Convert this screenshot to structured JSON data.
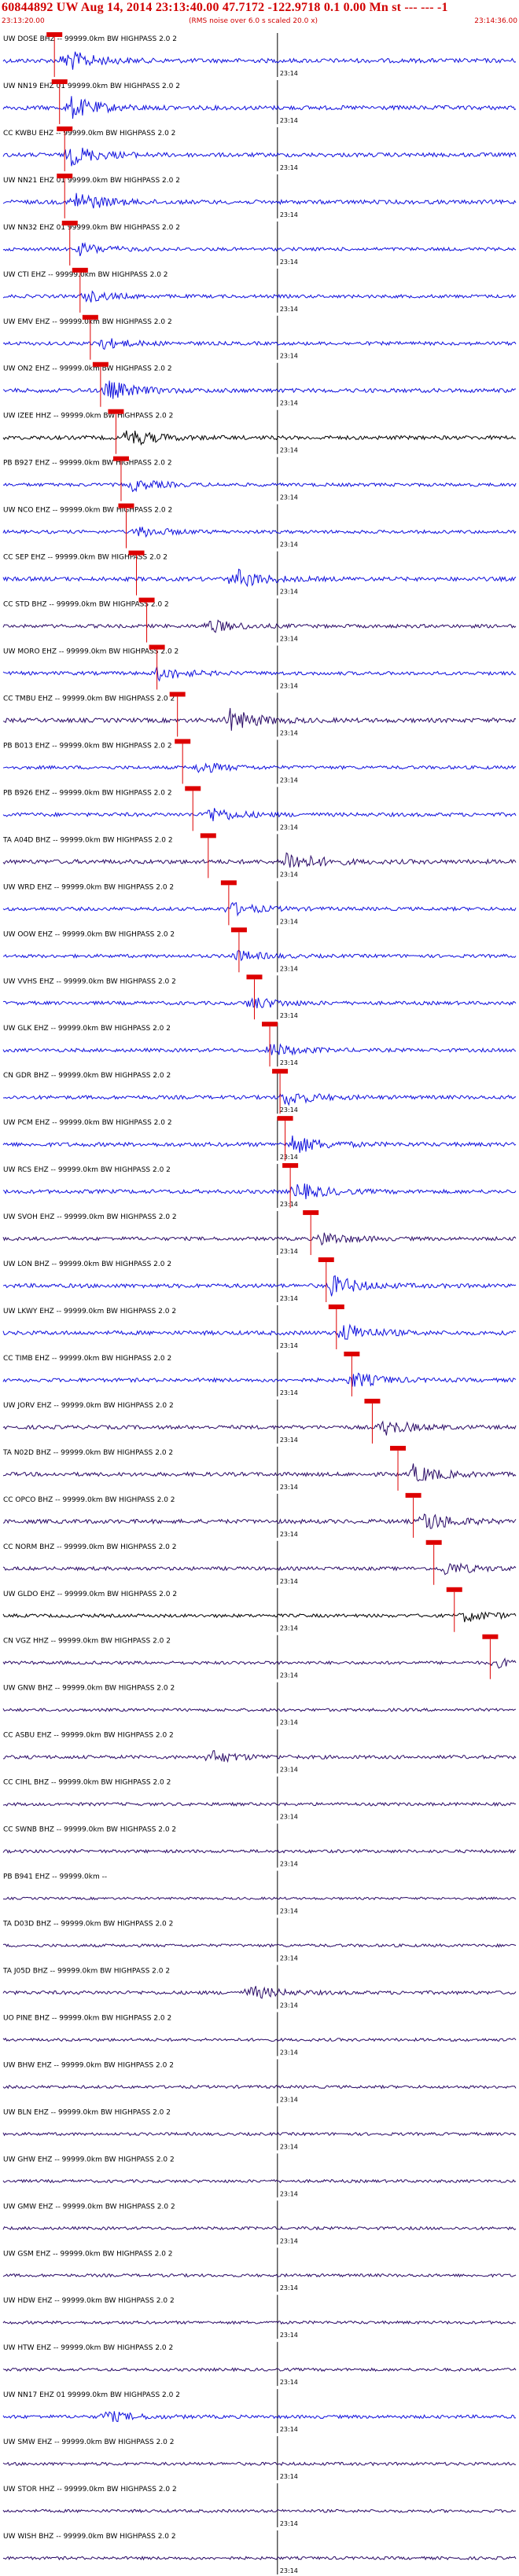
{
  "header": {
    "title": "60844892 UW Aug 14, 2014 23:13:40.00   47.7172 -122.9718  0.1 0.00 Mn st --- --- -1",
    "start_time": "23:13:20.00",
    "noise_note": "(RMS noise over 6.0 s scaled 20.0 x)",
    "end_time": "23:14:36.00"
  },
  "chart_data": {
    "type": "line",
    "time_tick_label": "23:14",
    "colors": {
      "trace_blue": "#1010dd",
      "trace_dark": "#2a0a66",
      "trace_black": "#000000",
      "pick": "#dd0000",
      "tick": "#000000"
    },
    "traces": [
      {
        "label": "UW DOSE BHZ -- 99999.0km BW  HIGHPASS  2.0  2",
        "color": "blue",
        "amp": 1.0,
        "burst": 0.12,
        "pick": 0.1
      },
      {
        "label": "UW NN19 EHZ 01 99999.0km BW  HIGHPASS  2.0  2",
        "color": "blue",
        "amp": 1.0,
        "burst": 0.13,
        "pick": 0.11
      },
      {
        "label": "CC KWBU EHZ -- 99999.0km BW  HIGHPASS  2.0  2",
        "color": "blue",
        "amp": 0.9,
        "burst": 0.13,
        "pick": 0.12
      },
      {
        "label": "UW NN21 EHZ 01 99999.0km BW  HIGHPASS  2.0  2",
        "color": "blue",
        "amp": 0.9,
        "burst": 0.14,
        "pick": 0.12
      },
      {
        "label": "UW NN32 EHZ 01 99999.0km BW  HIGHPASS  2.0  2",
        "color": "blue",
        "amp": 0.5,
        "burst": 0.15,
        "pick": 0.13
      },
      {
        "label": "UW CTI  EHZ -- 99999.0km BW  HIGHPASS  2.0  2",
        "color": "blue",
        "amp": 0.5,
        "burst": 0.16,
        "pick": 0.15
      },
      {
        "label": "UW EMV  EHZ -- 99999.0km BW  HIGHPASS  2.0  2",
        "color": "blue",
        "amp": 0.6,
        "burst": 0.18,
        "pick": 0.17
      },
      {
        "label": "UW ON2 EHZ -- 99999.0km BW  HIGHPASS  2.0  2",
        "color": "blue",
        "amp": 0.9,
        "burst": 0.2,
        "pick": 0.19
      },
      {
        "label": "UW IZEE HHZ -- 99999.0km BW  HIGHPASS  2.0  2",
        "color": "black",
        "amp": 0.8,
        "burst": 0.24,
        "pick": 0.22
      },
      {
        "label": "PB B927 EHZ -- 99999.0km BW  HIGHPASS  2.0  2",
        "color": "blue",
        "amp": 0.5,
        "burst": 0.25,
        "pick": 0.23
      },
      {
        "label": "UW NCO  EHZ -- 99999.0km BW  HIGHPASS  2.0  2",
        "color": "blue",
        "amp": 0.5,
        "burst": 0.26,
        "pick": 0.24
      },
      {
        "label": "CC SEP  EHZ -- 99999.0km BW  HIGHPASS  2.0  2",
        "color": "blue",
        "amp": 0.9,
        "burst": 0.45,
        "pick": 0.26
      },
      {
        "label": "CC STD  BHZ -- 99999.0km BW  HIGHPASS  2.0  2",
        "color": "dark",
        "amp": 0.6,
        "burst": 0.4,
        "pick": 0.28
      },
      {
        "label": "UW MORO EHZ -- 99999.0km BW  HIGHPASS  2.0  2",
        "color": "blue",
        "amp": 0.6,
        "burst": 0.3,
        "pick": 0.3
      },
      {
        "label": "CC TMBU EHZ -- 99999.0km BW  HIGHPASS  2.0  2",
        "color": "dark",
        "amp": 1.0,
        "burst": 0.44,
        "pick": 0.34
      },
      {
        "label": "PB B013 EHZ -- 99999.0km BW  HIGHPASS  2.0  2",
        "color": "blue",
        "amp": 0.5,
        "burst": 0.38,
        "pick": 0.35
      },
      {
        "label": "PB B926 EHZ -- 99999.0km BW  HIGHPASS  2.0  2",
        "color": "blue",
        "amp": 0.7,
        "burst": 0.4,
        "pick": 0.37
      },
      {
        "label": "TA A04D BHZ -- 99999.0km BW  HIGHPASS  2.0  2",
        "color": "dark",
        "amp": 1.0,
        "burst": 0.55,
        "pick": 0.4
      },
      {
        "label": "UW WRD  EHZ -- 99999.0km BW  HIGHPASS  2.0  2",
        "color": "blue",
        "amp": 0.6,
        "burst": 0.44,
        "pick": 0.44
      },
      {
        "label": "UW OOW  EHZ -- 99999.0km BW  HIGHPASS  2.0  2",
        "color": "blue",
        "amp": 0.5,
        "burst": 0.45,
        "pick": 0.46
      },
      {
        "label": "UW VVHS EHZ -- 99999.0km BW  HIGHPASS  2.0  2",
        "color": "blue",
        "amp": 0.6,
        "burst": 0.48,
        "pick": 0.49
      },
      {
        "label": "UW GLK  EHZ -- 99999.0km BW  HIGHPASS  2.0  2",
        "color": "blue",
        "amp": 0.6,
        "burst": 0.52,
        "pick": 0.52
      },
      {
        "label": "CN GDR  BHZ -- 99999.0km BW  HIGHPASS  2.0  2",
        "color": "blue",
        "amp": 0.7,
        "burst": 0.55,
        "pick": 0.54
      },
      {
        "label": "UW PCM  EHZ -- 99999.0km BW  HIGHPASS  2.0  2",
        "color": "blue",
        "amp": 0.9,
        "burst": 0.56,
        "pick": 0.55
      },
      {
        "label": "UW RCS  EHZ -- 99999.0km BW  HIGHPASS  2.0  2",
        "color": "blue",
        "amp": 0.8,
        "burst": 0.57,
        "pick": 0.56
      },
      {
        "label": "UW SVOH EHZ -- 99999.0km BW  HIGHPASS  2.0  2",
        "color": "dark",
        "amp": 0.6,
        "burst": 0.62,
        "pick": 0.6
      },
      {
        "label": "UW LON  BHZ -- 99999.0km BW  HIGHPASS  2.0  2",
        "color": "blue",
        "amp": 0.9,
        "burst": 0.64,
        "pick": 0.63
      },
      {
        "label": "UW LKWY EHZ -- 99999.0km BW  HIGHPASS  2.0  2",
        "color": "blue",
        "amp": 0.9,
        "burst": 0.66,
        "pick": 0.65
      },
      {
        "label": "CC TIMB EHZ -- 99999.0km BW  HIGHPASS  2.0  2",
        "color": "blue",
        "amp": 0.7,
        "burst": 0.68,
        "pick": 0.68
      },
      {
        "label": "UW JORV EHZ -- 99999.0km BW  HIGHPASS  2.0  2",
        "color": "dark",
        "amp": 0.7,
        "burst": 0.74,
        "pick": 0.72
      },
      {
        "label": "TA N02D BHZ -- 99999.0km BW  HIGHPASS  2.0  2",
        "color": "dark",
        "amp": 0.8,
        "burst": 0.8,
        "pick": 0.77
      },
      {
        "label": "CC OPCO BHZ -- 99999.0km BW  HIGHPASS  2.0  2",
        "color": "dark",
        "amp": 0.9,
        "burst": 0.82,
        "pick": 0.8
      },
      {
        "label": "CC NORM BHZ -- 99999.0km BW  HIGHPASS  2.0  2",
        "color": "dark",
        "amp": 0.6,
        "burst": 0.86,
        "pick": 0.84
      },
      {
        "label": "UW GLDO EHZ -- 99999.0km BW  HIGHPASS  2.0  2",
        "color": "black",
        "amp": 0.5,
        "burst": 0.9,
        "pick": 0.88
      },
      {
        "label": "CN VGZ  HHZ -- 99999.0km BW  HIGHPASS  2.0  2",
        "color": "dark",
        "amp": 0.4,
        "burst": 0.96,
        "pick": 0.95
      },
      {
        "label": "UW GNW  BHZ -- 99999.0km BW  HIGHPASS  2.0  2",
        "color": "dark",
        "amp": 0.3,
        "burst": -1,
        "pick": -1
      },
      {
        "label": "CC ASBU EHZ -- 99999.0km BW  HIGHPASS  2.0  2",
        "color": "dark",
        "amp": 0.6,
        "burst": 0.4,
        "pick": -1
      },
      {
        "label": "CC CIHL BHZ -- 99999.0km BW  HIGHPASS  2.0  2",
        "color": "dark",
        "amp": 0.4,
        "burst": -1,
        "pick": -1
      },
      {
        "label": "CC SWNB BHZ -- 99999.0km BW  HIGHPASS  2.0  2",
        "color": "dark",
        "amp": 0.4,
        "burst": -1,
        "pick": -1
      },
      {
        "label": "PB B941 EHZ -- 99999.0km --",
        "color": "dark",
        "amp": 0.0,
        "burst": -1,
        "pick": -1
      },
      {
        "label": "TA D03D BHZ -- 99999.0km BW  HIGHPASS  2.0  2",
        "color": "dark",
        "amp": 0.3,
        "burst": -1,
        "pick": -1
      },
      {
        "label": "TA J05D BHZ -- 99999.0km BW  HIGHPASS  2.0  2",
        "color": "dark",
        "amp": 0.6,
        "burst": 0.48,
        "pick": -1
      },
      {
        "label": "UO PINE BHZ -- 99999.0km BW  HIGHPASS  2.0  2",
        "color": "dark",
        "amp": 0.3,
        "burst": -1,
        "pick": -1
      },
      {
        "label": "UW BHW  EHZ -- 99999.0km BW  HIGHPASS  2.0  2",
        "color": "dark",
        "amp": 0.3,
        "burst": -1,
        "pick": -1
      },
      {
        "label": "UW BLN  EHZ -- 99999.0km BW  HIGHPASS  2.0  2",
        "color": "dark",
        "amp": 0.3,
        "burst": -1,
        "pick": -1
      },
      {
        "label": "UW GHW  EHZ -- 99999.0km BW  HIGHPASS  2.0  2",
        "color": "dark",
        "amp": 0.3,
        "burst": -1,
        "pick": -1
      },
      {
        "label": "UW GMW  EHZ -- 99999.0km BW  HIGHPASS  2.0  2",
        "color": "dark",
        "amp": 0.3,
        "burst": -1,
        "pick": -1
      },
      {
        "label": "UW GSM  EHZ -- 99999.0km BW  HIGHPASS  2.0  2",
        "color": "dark",
        "amp": 0.3,
        "burst": -1,
        "pick": -1
      },
      {
        "label": "UW HDW  EHZ -- 99999.0km BW  HIGHPASS  2.0  2",
        "color": "dark",
        "amp": 0.3,
        "burst": -1,
        "pick": -1
      },
      {
        "label": "UW HTW  EHZ -- 99999.0km BW  HIGHPASS  2.0  2",
        "color": "dark",
        "amp": 0.3,
        "burst": -1,
        "pick": -1
      },
      {
        "label": "UW NN17 EHZ 01 99999.0km BW  HIGHPASS  2.0  2",
        "color": "blue",
        "amp": 0.5,
        "burst": 0.2,
        "pick": -1
      },
      {
        "label": "UW SMW  EHZ -- 99999.0km BW  HIGHPASS  2.0  2",
        "color": "dark",
        "amp": 0.4,
        "burst": -1,
        "pick": -1
      },
      {
        "label": "UW STOR HHZ -- 99999.0km BW  HIGHPASS  2.0  2",
        "color": "dark",
        "amp": 0.3,
        "burst": -1,
        "pick": -1
      },
      {
        "label": "UW WISH BHZ -- 99999.0km BW  HIGHPASS  2.0  2",
        "color": "dark",
        "amp": 0.3,
        "burst": -1,
        "pick": -1
      }
    ]
  }
}
